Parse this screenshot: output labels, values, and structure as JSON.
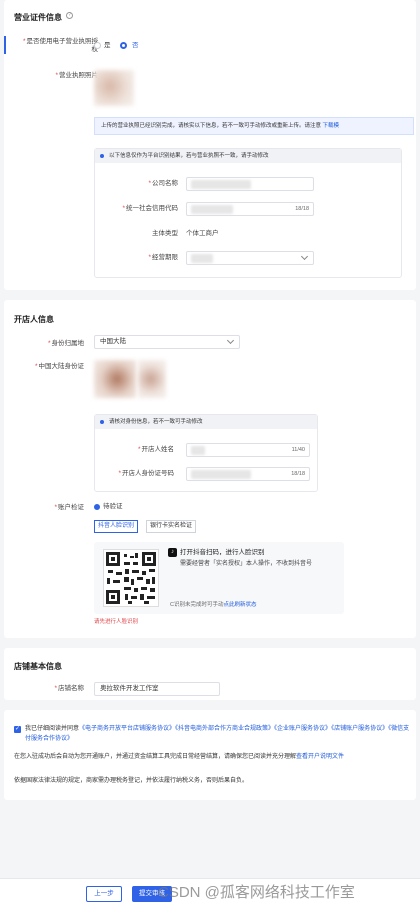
{
  "license": {
    "title": "营业证件信息",
    "three_in_one_label": "是否使用电子营业执照授权",
    "radio_yes": "是",
    "radio_no": "否",
    "photo_label": "营业执照照片",
    "notice_text": "上传的营业执照已经识别完成，请核实以下信息，若不一致可手动修改或重新上传。请注意",
    "notice_link": "下载模",
    "sub_header": "以下信息仅作为平台识别结果，若与营业执照不一致，请手动修改",
    "company_name_label": "公司名称",
    "credit_code_label": "统一社会信用代码",
    "credit_code_counter": "18/18",
    "subject_type_label": "主体类型",
    "subject_type_value": "个体工商户",
    "operating_period_label": "经营期限"
  },
  "shopkeeper": {
    "title": "开店人信息",
    "id_region_label": "身份归属地",
    "id_region_value": "中国大陆",
    "id_photo_label": "中国大陆身份证",
    "sub_header": "请核对身份信息，若不一致可手动修改",
    "name_label": "开店人姓名",
    "name_counter": "11/40",
    "id_number_label": "开店人身份证号码",
    "id_number_counter": "18/18",
    "verify_label": "账户检证",
    "verify_option": "待验证",
    "tab_face": "抖音人脸识别",
    "tab_bank": "银行卡实名检证",
    "qr_line1": "打开抖音扫码，进行人脸识别",
    "qr_line2": "需要经营者「实名授权」本人操作，不收到抖音号",
    "qr_refresh_prefix": "C识别未完成时可手动",
    "qr_refresh_link": "点此刷新状态",
    "verify_error": "请先进行人脸识别"
  },
  "store": {
    "title": "店铺基本信息",
    "name_label": "店铺名称",
    "name_value": "奥拉软件开发工作室"
  },
  "agreement": {
    "line1_prefix": "我已仔细阅读并同意",
    "doc1": "《电子商务开放平台店铺服务协议》",
    "doc2": "《抖音电商外部合作方商业合规政策》",
    "doc3": "《企业账户服务协议》",
    "doc4": "《店铺账户服务协议》",
    "doc5": "《微信支付服务合作协议》",
    "line2": "在您入驻成功后会自动为您开通账户，并通过资金结算工具完成日常经营结算，请确保您已阅读并充分理解",
    "line2_link": "查看开户说明文件",
    "line3": "依据国家法律法规的规定，商家需办理税务登记，并依法履行纳税义务，否则后果自负。"
  },
  "footer": {
    "prev_button": "上一步",
    "submit_button": "提交审核",
    "watermark": "CSDN @孤客网络科技工作室"
  },
  "colors": {
    "accent": "#2f62e6",
    "error": "#e0454a",
    "notice_bg": "#eef3ff"
  }
}
